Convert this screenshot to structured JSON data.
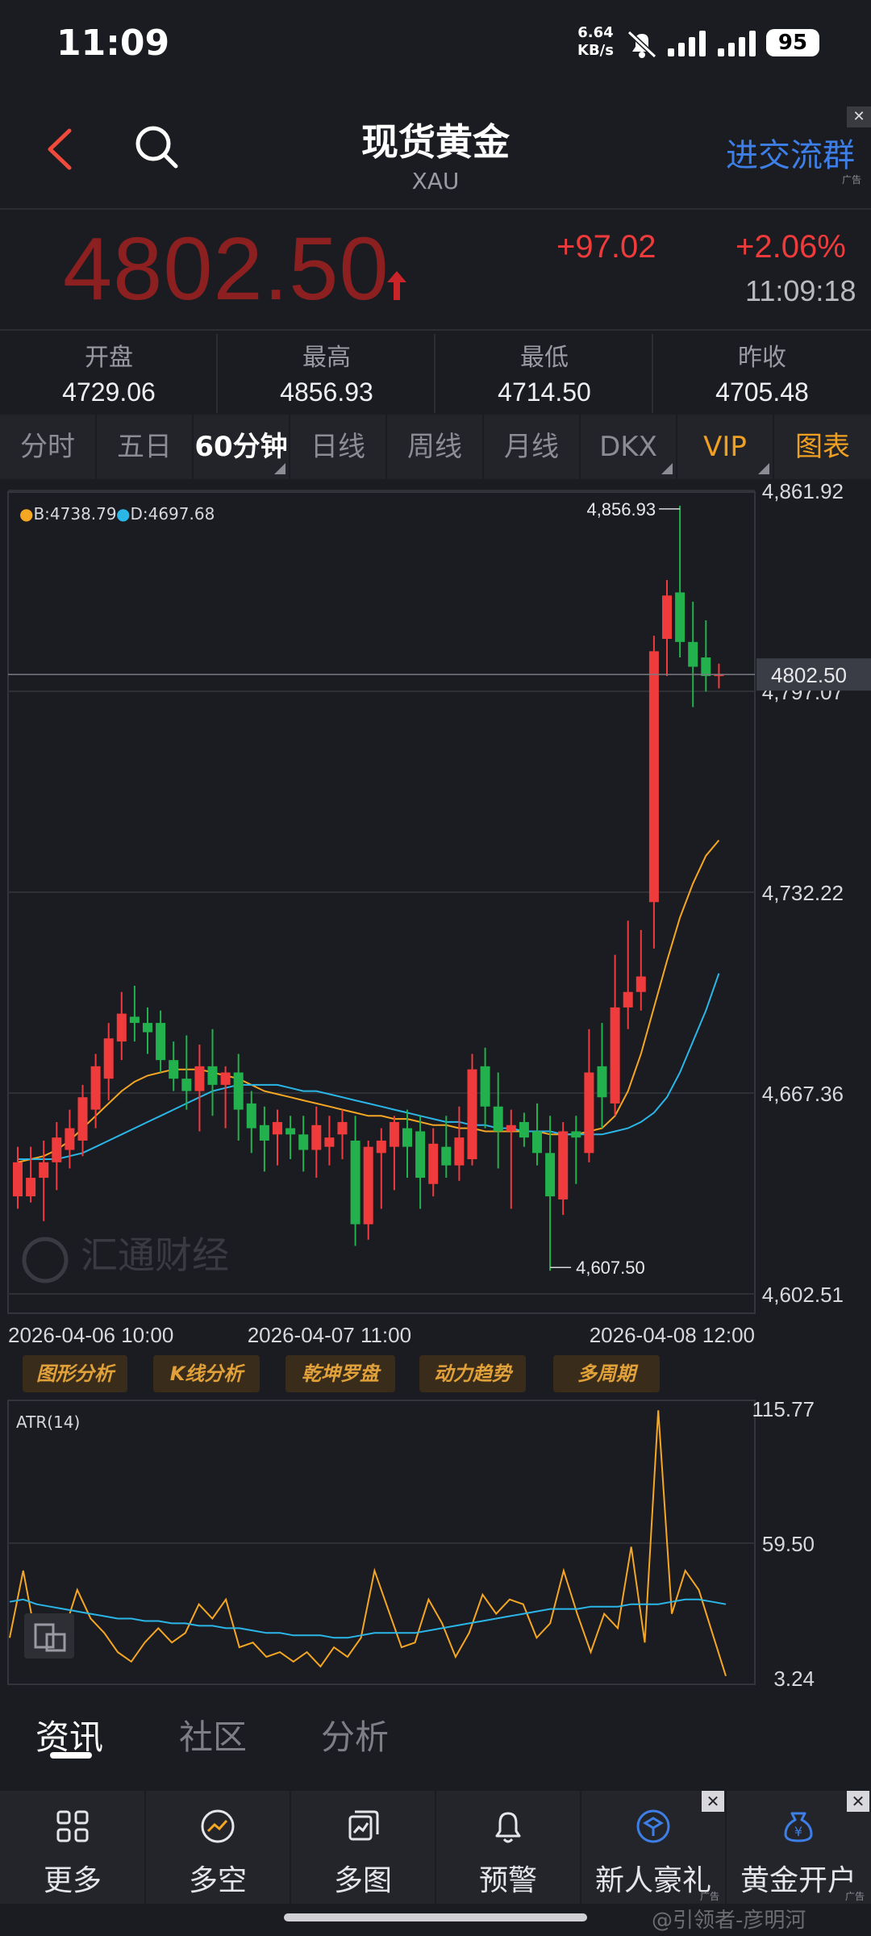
{
  "status_bar": {
    "time": "11:09",
    "net_speed_value": "6.64",
    "net_speed_unit": "KB/s",
    "battery": "95"
  },
  "header": {
    "title": "现货黄金",
    "subtitle": "XAU",
    "join_group": "进交流群",
    "ad_tag": "广告",
    "ad_close": "✕"
  },
  "quote": {
    "last_price": "4802.50",
    "change": "+97.02",
    "change_percent": "+2.06%",
    "time": "11:09:18",
    "up_color": "#ef3b3b",
    "down_color": "#22b14c"
  },
  "stats": [
    {
      "label": "开盘",
      "value": "4729.06"
    },
    {
      "label": "最高",
      "value": "4856.93"
    },
    {
      "label": "最低",
      "value": "4714.50"
    },
    {
      "label": "昨收",
      "value": "4705.48"
    }
  ],
  "period_tabs": [
    {
      "label": "分时"
    },
    {
      "label": "五日"
    },
    {
      "label": "60分钟",
      "active": true
    },
    {
      "label": "日线"
    },
    {
      "label": "周线"
    },
    {
      "label": "月线"
    },
    {
      "label": "DKX"
    },
    {
      "label": "VIP"
    },
    {
      "label": "图表"
    }
  ],
  "chart_legend": {
    "b_label": "B:4738.79",
    "b_color": "#f5a623",
    "d_label": "D:4697.68",
    "d_color": "#2bb6e8"
  },
  "chart_data": [
    {
      "type": "candlestick",
      "title": "",
      "y_ticks": [
        "4,861.92",
        "4,797.07",
        "4,732.22",
        "4,667.36",
        "4,602.51"
      ],
      "y_tick_values": [
        4861.92,
        4797.07,
        4732.22,
        4667.36,
        4602.51
      ],
      "ylim": [
        4602.51,
        4861.92
      ],
      "x_ticks": [
        "2026-04-06 10:00",
        "2026-04-07 11:00",
        "2026-04-08 12:00"
      ],
      "x_tick_index": [
        0,
        24,
        48
      ],
      "current_price_label": "4802.50",
      "current_price": 4802.5,
      "high_label": "4,856.93",
      "low_label": "4,607.50",
      "candles": [
        {
          "o": 4634,
          "h": 4650,
          "l": 4630,
          "c": 4645
        },
        {
          "o": 4634,
          "h": 4650,
          "l": 4632,
          "c": 4640
        },
        {
          "o": 4640,
          "h": 4652,
          "l": 4626,
          "c": 4645
        },
        {
          "o": 4645,
          "h": 4658,
          "l": 4636,
          "c": 4653
        },
        {
          "o": 4649,
          "h": 4662,
          "l": 4643,
          "c": 4656
        },
        {
          "o": 4652,
          "h": 4670,
          "l": 4647,
          "c": 4666
        },
        {
          "o": 4662,
          "h": 4680,
          "l": 4656,
          "c": 4676
        },
        {
          "o": 4672,
          "h": 4690,
          "l": 4665,
          "c": 4685
        },
        {
          "o": 4684,
          "h": 4700,
          "l": 4678,
          "c": 4693
        },
        {
          "o": 4692,
          "h": 4702,
          "l": 4684,
          "c": 4690
        },
        {
          "o": 4690,
          "h": 4695,
          "l": 4680,
          "c": 4687
        },
        {
          "o": 4690,
          "h": 4694,
          "l": 4674,
          "c": 4678
        },
        {
          "o": 4678,
          "h": 4684,
          "l": 4668,
          "c": 4672
        },
        {
          "o": 4672,
          "h": 4686,
          "l": 4662,
          "c": 4668
        },
        {
          "o": 4668,
          "h": 4683,
          "l": 4655,
          "c": 4676
        },
        {
          "o": 4676,
          "h": 4688,
          "l": 4660,
          "c": 4670
        },
        {
          "o": 4670,
          "h": 4676,
          "l": 4656,
          "c": 4674
        },
        {
          "o": 4674,
          "h": 4680,
          "l": 4652,
          "c": 4662
        },
        {
          "o": 4664,
          "h": 4668,
          "l": 4648,
          "c": 4656
        },
        {
          "o": 4657,
          "h": 4663,
          "l": 4642,
          "c": 4652
        },
        {
          "o": 4654,
          "h": 4662,
          "l": 4644,
          "c": 4658
        },
        {
          "o": 4656,
          "h": 4660,
          "l": 4646,
          "c": 4654
        },
        {
          "o": 4654,
          "h": 4660,
          "l": 4642,
          "c": 4649
        },
        {
          "o": 4649,
          "h": 4663,
          "l": 4640,
          "c": 4657
        },
        {
          "o": 4650,
          "h": 4660,
          "l": 4644,
          "c": 4653
        },
        {
          "o": 4654,
          "h": 4662,
          "l": 4646,
          "c": 4658
        },
        {
          "o": 4652,
          "h": 4660,
          "l": 4618,
          "c": 4625
        },
        {
          "o": 4625,
          "h": 4652,
          "l": 4620,
          "c": 4650
        },
        {
          "o": 4648,
          "h": 4656,
          "l": 4630,
          "c": 4652
        },
        {
          "o": 4650,
          "h": 4660,
          "l": 4636,
          "c": 4658
        },
        {
          "o": 4656,
          "h": 4662,
          "l": 4640,
          "c": 4650
        },
        {
          "o": 4655,
          "h": 4660,
          "l": 4630,
          "c": 4640
        },
        {
          "o": 4638,
          "h": 4656,
          "l": 4634,
          "c": 4651
        },
        {
          "o": 4650,
          "h": 4660,
          "l": 4640,
          "c": 4644
        },
        {
          "o": 4644,
          "h": 4663,
          "l": 4639,
          "c": 4653
        },
        {
          "o": 4646,
          "h": 4680,
          "l": 4644,
          "c": 4675
        },
        {
          "o": 4676,
          "h": 4682,
          "l": 4656,
          "c": 4663
        },
        {
          "o": 4663,
          "h": 4674,
          "l": 4643,
          "c": 4655
        },
        {
          "o": 4655,
          "h": 4662,
          "l": 4630,
          "c": 4657
        },
        {
          "o": 4658,
          "h": 4661,
          "l": 4650,
          "c": 4653
        },
        {
          "o": 4655,
          "h": 4664,
          "l": 4644,
          "c": 4648
        },
        {
          "o": 4648,
          "h": 4660,
          "l": 4610,
          "c": 4634
        },
        {
          "o": 4633,
          "h": 4658,
          "l": 4628,
          "c": 4655
        },
        {
          "o": 4655,
          "h": 4660,
          "l": 4638,
          "c": 4653
        },
        {
          "o": 4648,
          "h": 4688,
          "l": 4645,
          "c": 4674
        },
        {
          "o": 4676,
          "h": 4690,
          "l": 4656,
          "c": 4666
        },
        {
          "o": 4664,
          "h": 4712,
          "l": 4660,
          "c": 4695
        },
        {
          "o": 4695,
          "h": 4723,
          "l": 4688,
          "c": 4700
        },
        {
          "o": 4700,
          "h": 4720,
          "l": 4694,
          "c": 4705
        },
        {
          "o": 4729,
          "h": 4815,
          "l": 4714,
          "c": 4810
        },
        {
          "o": 4814,
          "h": 4833,
          "l": 4802,
          "c": 4828
        },
        {
          "o": 4829,
          "h": 4857,
          "l": 4808,
          "c": 4813
        },
        {
          "o": 4813,
          "h": 4826,
          "l": 4792,
          "c": 4805
        },
        {
          "o": 4808,
          "h": 4820,
          "l": 4797,
          "c": 4802
        },
        {
          "o": 4802,
          "h": 4806,
          "l": 4798,
          "c": 4802.5
        }
      ],
      "series": [
        {
          "name": "B",
          "color": "#f5a623",
          "values": [
            4645,
            4646,
            4647,
            4649,
            4652,
            4656,
            4660,
            4664,
            4668,
            4671,
            4673,
            4674,
            4675,
            4675,
            4675,
            4674,
            4673,
            4672,
            4670,
            4668,
            4667,
            4666,
            4665,
            4664,
            4663,
            4662,
            4661,
            4660,
            4660,
            4659,
            4659,
            4658,
            4657,
            4657,
            4656,
            4656,
            4655,
            4655,
            4655,
            4655,
            4655,
            4654,
            4654,
            4654,
            4655,
            4656,
            4660,
            4668,
            4680,
            4695,
            4710,
            4724,
            4735,
            4744,
            4749
          ]
        },
        {
          "name": "D",
          "color": "#2bb6e8",
          "values": [
            4646,
            4646,
            4646,
            4646,
            4647,
            4648,
            4650,
            4652,
            4654,
            4656,
            4658,
            4660,
            4662,
            4664,
            4666,
            4668,
            4669,
            4670,
            4670,
            4670,
            4670,
            4669,
            4668,
            4668,
            4667,
            4666,
            4665,
            4664,
            4663,
            4662,
            4661,
            4660,
            4659,
            4658,
            4658,
            4657,
            4657,
            4656,
            4656,
            4655,
            4655,
            4655,
            4654,
            4654,
            4654,
            4654,
            4655,
            4656,
            4658,
            4661,
            4666,
            4674,
            4684,
            4694,
            4706
          ]
        }
      ]
    },
    {
      "type": "line",
      "title": "ATR(14)",
      "y_ticks": [
        "115.77",
        "59.50",
        "3.24"
      ],
      "y_tick_values": [
        115.77,
        59.5,
        3.24
      ],
      "ylim": [
        3.24,
        115.77
      ],
      "series": [
        {
          "name": "",
          "color": "#f5a623",
          "values": [
            20,
            48,
            18,
            14,
            22,
            40,
            28,
            22,
            14,
            10,
            18,
            24,
            18,
            22,
            34,
            28,
            36,
            16,
            18,
            12,
            14,
            10,
            14,
            8,
            16,
            12,
            20,
            48,
            32,
            16,
            18,
            36,
            26,
            12,
            22,
            38,
            30,
            36,
            34,
            20,
            26,
            48,
            30,
            14,
            30,
            24,
            58,
            18,
            115,
            30,
            48,
            40,
            22,
            4
          ]
        },
        {
          "name": "",
          "color": "#2bb6e8",
          "values": [
            35,
            36,
            34,
            33,
            32,
            31,
            30,
            29,
            28,
            28,
            27,
            27,
            26,
            26,
            25,
            25,
            24,
            24,
            23,
            22,
            22,
            21,
            21,
            21,
            20,
            20,
            21,
            22,
            22,
            22,
            22,
            23,
            24,
            25,
            26,
            27,
            28,
            29,
            30,
            31,
            32,
            32,
            32,
            33,
            33,
            33,
            34,
            34,
            34,
            35,
            36,
            36,
            35,
            34
          ]
        }
      ]
    }
  ],
  "chart_watermark": "汇通财经",
  "tools": [
    "图形分析",
    "K线分析",
    "乾坤罗盘",
    "动力趋势",
    "多周期"
  ],
  "bottom_tabs": [
    {
      "label": "资讯",
      "active": true
    },
    {
      "label": "社区"
    },
    {
      "label": "分析"
    }
  ],
  "bottom_bar": [
    {
      "label": "更多",
      "icon": "grid-icon"
    },
    {
      "label": "多空",
      "icon": "trend-icon"
    },
    {
      "label": "多图",
      "icon": "multi-chart-icon"
    },
    {
      "label": "预警",
      "icon": "bell-icon"
    },
    {
      "label": "新人豪礼",
      "icon": "gift-icon",
      "ad": true
    },
    {
      "label": "黄金开户",
      "icon": "gold-bag-icon",
      "ad": true
    }
  ],
  "credit": "@引领者-彦明河"
}
